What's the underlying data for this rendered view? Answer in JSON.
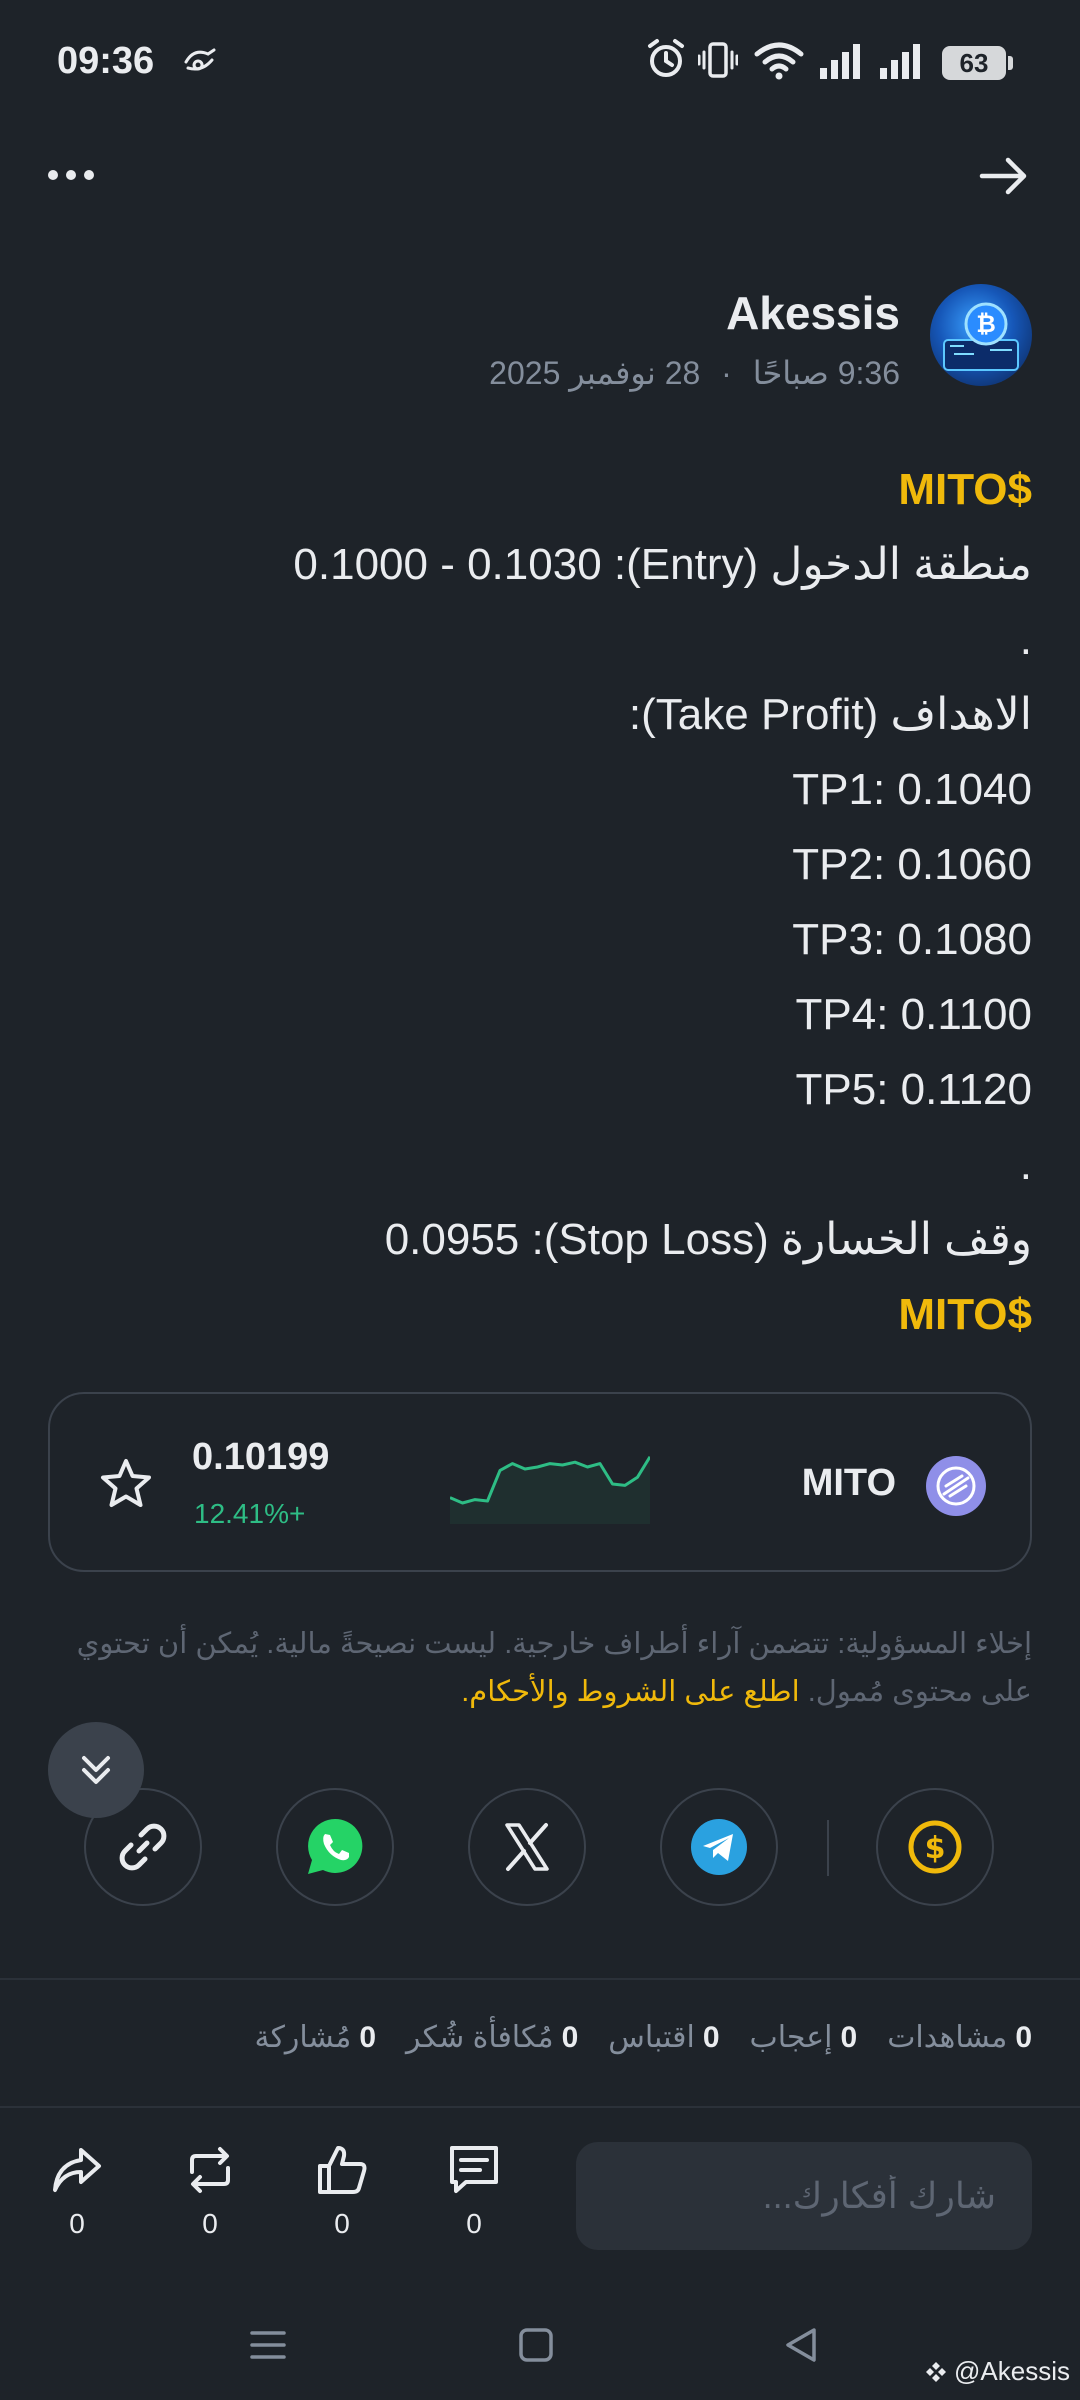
{
  "status_bar": {
    "time": "09:36",
    "battery": "63"
  },
  "header": {
    "menu_icon": "more-dots-icon",
    "back_icon": "arrow-right-icon"
  },
  "author": {
    "name": "Akessis",
    "time": "9:36 صباحًا",
    "separator": "·",
    "date": "28 نوفمبر 2025"
  },
  "post": {
    "lines": [
      "MITO$",
      "منطقة الدخول (Entry):  0.1000 - 0.1030",
      ".",
      "الاهداف (Take Profit):",
      "TP1: 0.1040",
      "TP2: 0.1060",
      "TP3: 0.1080",
      "TP4: 0.1100",
      "TP5: 0.1120",
      ".",
      "وقف الخسارة (Stop Loss): 0.0955",
      "MITO$"
    ]
  },
  "coin_card": {
    "name": "MITO",
    "price": "0.10199",
    "change": "12.41%+",
    "change_color": "#2ebd85",
    "sparkline_values": [
      0.3,
      0.22,
      0.27,
      0.25,
      0.7,
      0.8,
      0.72,
      0.75,
      0.8,
      0.78,
      0.82,
      0.75,
      0.8,
      0.5,
      0.48,
      0.6,
      0.9
    ]
  },
  "disclaimer": {
    "text": "إخلاء المسؤولية: تتضمن آراء أطراف خارجية. ليست نصيحةً مالية. يُمكن أن تحتوي على محتوى مُمول.",
    "link": "اطلع على الشروط والأحكام."
  },
  "share": {
    "buttons": [
      "tip-dollar-icon",
      "telegram-icon",
      "x-icon",
      "whatsapp-icon",
      "link-icon"
    ]
  },
  "stats": [
    {
      "count": "0",
      "label": "مشاهدات"
    },
    {
      "count": "0",
      "label": "إعجاب"
    },
    {
      "count": "0",
      "label": "اقتباس"
    },
    {
      "count": "0",
      "label": "مُكافأة شُكر"
    },
    {
      "count": "0",
      "label": "مُشاركة"
    }
  ],
  "actions": {
    "comment": "0",
    "like": "0",
    "repost": "0",
    "share": "0"
  },
  "comment_input": {
    "placeholder": "شارك أفكارك..."
  },
  "watermark": "@Akessis",
  "colors": {
    "background": "#1e2329",
    "accent": "#f0b90b",
    "positive": "#2ebd85",
    "muted": "#848e9c"
  }
}
